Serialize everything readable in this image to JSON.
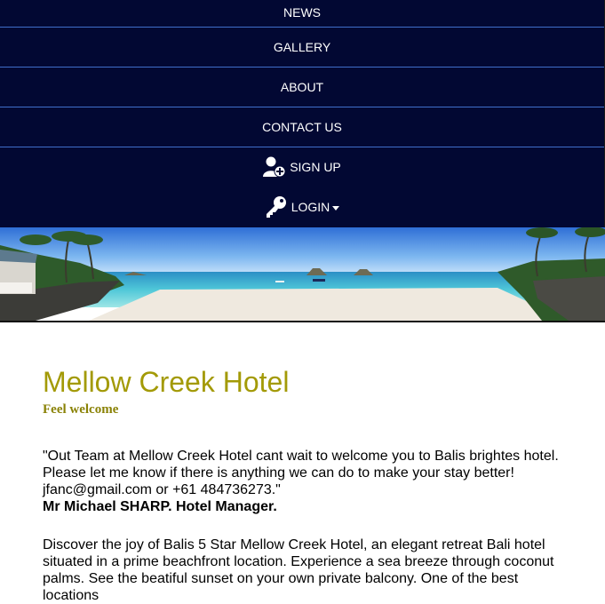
{
  "nav": {
    "news": "NEWS",
    "gallery": "GALLERY",
    "about": "ABOUT",
    "contact": "CONTACT US",
    "signup": "SIGN UP",
    "login": "LOGIN",
    "icons": {
      "signup": "add-user-icon",
      "login": "key-icon"
    },
    "colors": {
      "background": "#020833",
      "separator": "#3f6ec9"
    }
  },
  "banner": {
    "icon": "beach-panorama-image"
  },
  "main": {
    "title": "Mellow Creek Hotel",
    "subtitle": "Feel welcome",
    "quote": "\"Out Team at Mellow Creek Hotel cant wait to welcome you to Balis brightes hotel. Please let me know if there is anything we can do to make your stay better! jfanc@gmail.com or +61 484736273.\"",
    "signature": "Mr Michael SHARP. Hotel Manager.",
    "paragraph": "Discover the joy of Balis 5 Star Mellow Creek Hotel, an elegant retreat Bali hotel situated in a prime beachfront location. Experience a sea breeze through coconut palms. See the beatiful sunset on your own private balcony. One of the best locations",
    "colors": {
      "title": "#a39a07",
      "subtitle": "#8a8206"
    }
  }
}
